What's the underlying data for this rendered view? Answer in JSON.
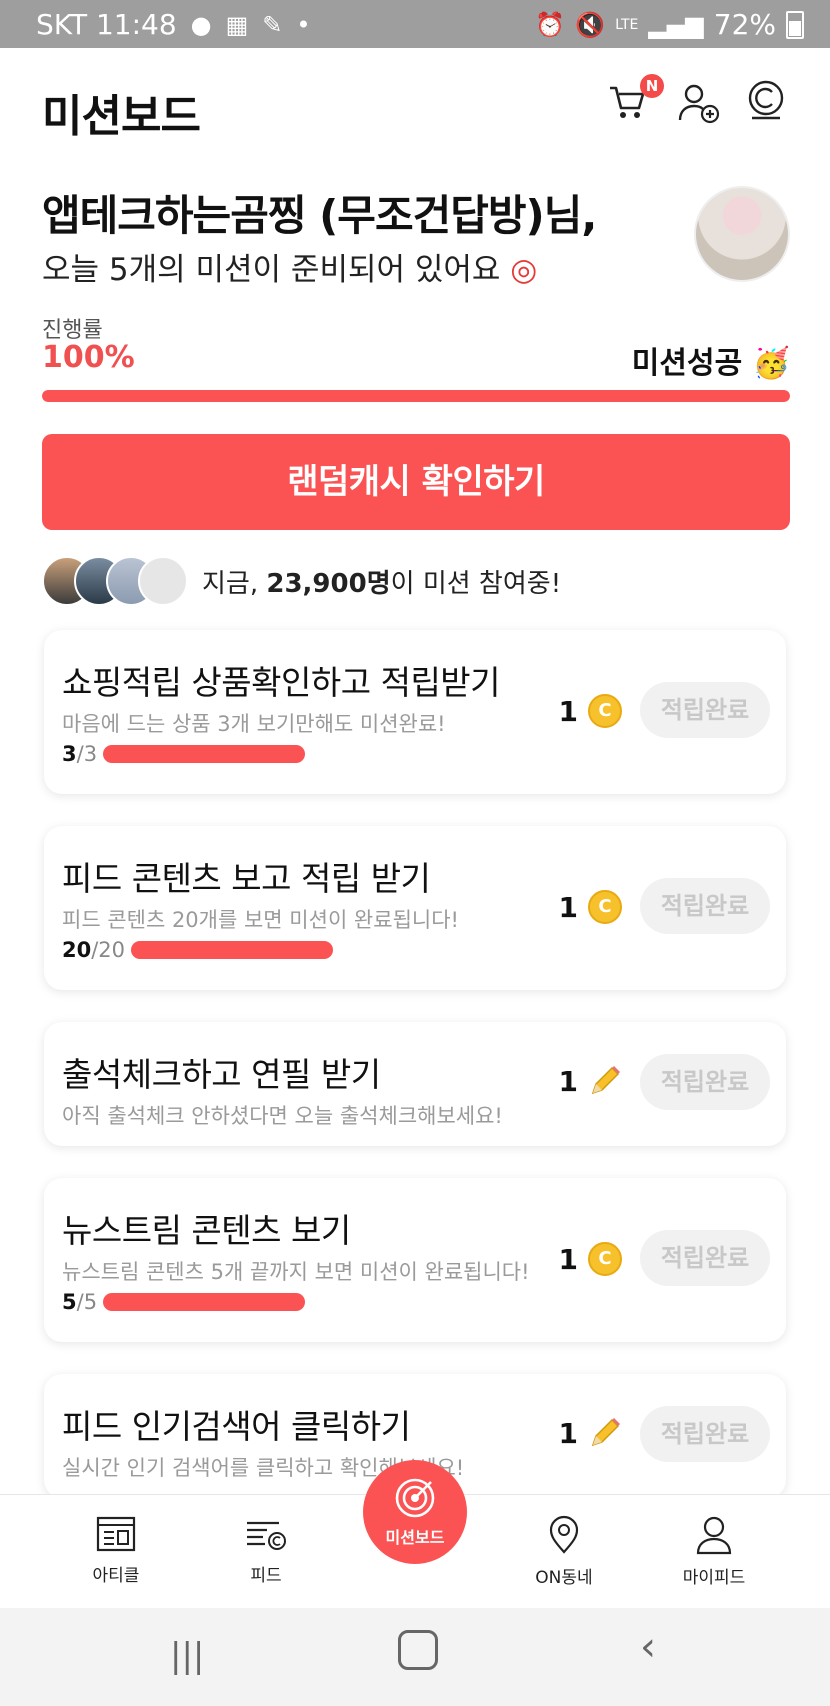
{
  "status_bar": {
    "carrier_time": "SKT 11:48",
    "battery": "72%",
    "network": "LTE"
  },
  "header": {
    "title": "미션보드",
    "cart_badge": "N"
  },
  "greeting": {
    "name": "앱테크하는곰찡 (무조건답방)님,",
    "subtitle": "오늘 5개의 미션이 준비되어 있어요"
  },
  "progress": {
    "label": "진행률",
    "value": "100%",
    "fraction": 1.0,
    "status": "미션성공"
  },
  "random_cash_button": "랜덤캐시 확인하기",
  "participants": {
    "prefix": "지금, ",
    "count": "23,900명",
    "suffix": "이 미션 참여중!"
  },
  "missions": [
    {
      "title": "쇼핑적립 상품확인하고 적립받기",
      "description": "마음에 드는 상품 3개 보기만해도 미션완료!",
      "progress_current": "3",
      "progress_total": "/3",
      "reward_amount": "1",
      "reward_icon": "coin-icon",
      "button": "적립완료"
    },
    {
      "title": "피드 콘텐츠 보고 적립 받기",
      "description": "피드 콘텐츠 20개를 보면 미션이 완료됩니다!",
      "progress_current": "20",
      "progress_total": "/20",
      "reward_amount": "1",
      "reward_icon": "coin-icon",
      "button": "적립완료"
    },
    {
      "title": "출석체크하고 연필 받기",
      "description": "아직 출석체크 안하셨다면 오늘 출석체크해보세요!",
      "reward_amount": "1",
      "reward_icon": "pencil-icon",
      "button": "적립완료"
    },
    {
      "title": "뉴스트림 콘텐츠 보기",
      "description": "뉴스트림 콘텐츠 5개 끝까지 보면 미션이 완료됩니다!",
      "progress_current": "5",
      "progress_total": "/5",
      "reward_amount": "1",
      "reward_icon": "coin-icon",
      "button": "적립완료"
    },
    {
      "title": "피드 인기검색어 클릭하기",
      "description": "실시간 인기 검색어를 클릭하고 확인해보세요!",
      "reward_amount": "1",
      "reward_icon": "pencil-icon",
      "button": "적립완료"
    }
  ],
  "bottom_nav": {
    "article": "아티클",
    "feed": "피드",
    "mission": "미션보드",
    "neighborhood": "ON동네",
    "my": "마이피드"
  },
  "colors": {
    "accent": "#fb5353",
    "coin": "#f6c12a",
    "done_bg": "#f1f1f1"
  }
}
